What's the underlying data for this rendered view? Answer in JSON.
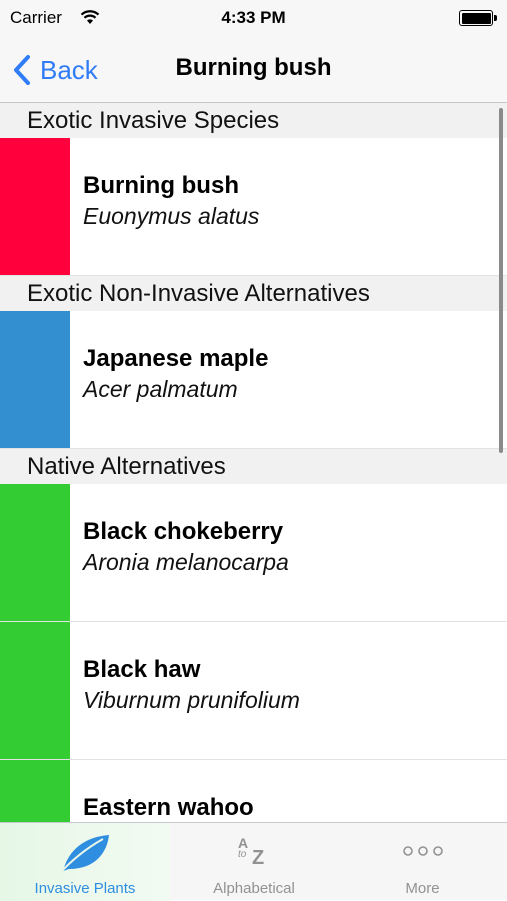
{
  "status_bar": {
    "carrier": "Carrier",
    "time": "4:33 PM"
  },
  "nav": {
    "back_label": "Back",
    "title": "Burning bush",
    "accent_color": "#2f7cf6"
  },
  "sections": [
    {
      "title": "Exotic Invasive Species",
      "rows": [
        {
          "common": "Burning bush",
          "latin": "Euonymus alatus",
          "color": "#ff003c"
        }
      ]
    },
    {
      "title": "Exotic Non-Invasive Alternatives",
      "rows": [
        {
          "common": "Japanese maple",
          "latin": "Acer palmatum",
          "color": "#338fd0"
        }
      ]
    },
    {
      "title": "Native Alternatives",
      "rows": [
        {
          "common": "Black chokeberry",
          "latin": "Aronia melanocarpa",
          "color": "#33cc33"
        },
        {
          "common": "Black haw",
          "latin": "Viburnum prunifolium",
          "color": "#33cc33"
        },
        {
          "common": "Eastern wahoo",
          "latin": "",
          "color": "#33cc33"
        }
      ]
    }
  ],
  "tab_bar": {
    "tabs": [
      {
        "label": "Invasive Plants",
        "icon": "leaf-icon",
        "active": true,
        "color": "#2f8ee0"
      },
      {
        "label": "Alphabetical",
        "icon": "a-to-z-icon",
        "active": false,
        "color": "#929292"
      },
      {
        "label": "More",
        "icon": "more-icon",
        "active": false,
        "color": "#929292"
      }
    ],
    "az_glyph": {
      "top": "A",
      "middle": "to",
      "bottom": "Z"
    }
  }
}
